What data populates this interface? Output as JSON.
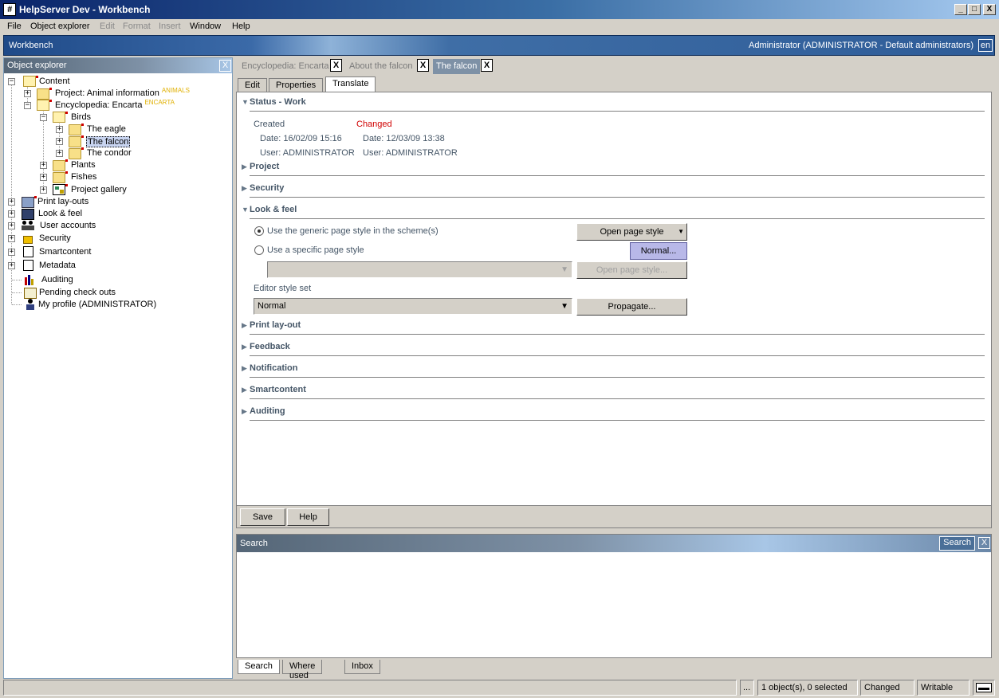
{
  "window": {
    "title": "HelpServer Dev - Workbench",
    "app_icon": "#",
    "minimize": "_",
    "maximize": "□",
    "close": "X"
  },
  "menu": {
    "file": "File",
    "object_explorer": "Object explorer",
    "edit": "Edit",
    "format": "Format",
    "insert": "Insert",
    "window": "Window",
    "help": "Help"
  },
  "header": {
    "title": "Workbench",
    "user": "Administrator (ADMINISTRATOR - Default administrators)",
    "lang": "en"
  },
  "explorer": {
    "title": "Object explorer",
    "close": "X",
    "tree": {
      "content": "Content",
      "project_animal": "Project: Animal information",
      "project_animal_badge": "ANIMALS",
      "encyclopedia": "Encyclopedia: Encarta",
      "encyclopedia_badge": "ENCARTA",
      "birds": "Birds",
      "eagle": "The eagle",
      "falcon": "The falcon",
      "condor": "The condor",
      "plants": "Plants",
      "fishes": "Fishes",
      "project_gallery": "Project gallery",
      "print_layouts": "Print lay-outs",
      "look_feel": "Look & feel",
      "user_accounts": "User accounts",
      "security": "Security",
      "smartcontent": "Smartcontent",
      "metadata": "Metadata",
      "auditing": "Auditing",
      "pending": "Pending check outs",
      "profile": "My profile (ADMINISTRATOR)"
    }
  },
  "doc_tabs": {
    "tab1": "Encyclopedia: Encarta",
    "tab2": "About the falcon",
    "tab3": "The falcon",
    "close": "X"
  },
  "sub_tabs": {
    "edit": "Edit",
    "properties": "Properties",
    "translate": "Translate"
  },
  "sections": {
    "status": "Status - Work",
    "project": "Project",
    "security": "Security",
    "look_feel": "Look & feel",
    "print_layout": "Print lay-out",
    "feedback": "Feedback",
    "notification": "Notification",
    "smartcontent": "Smartcontent",
    "auditing": "Auditing"
  },
  "status": {
    "created_label": "Created",
    "changed_label": "Changed",
    "created_date": "Date:  16/02/09 15:16",
    "created_user": "User:  ADMINISTRATOR",
    "changed_date": "Date:  12/03/09 13:38",
    "changed_user": "User:  ADMINISTRATOR"
  },
  "look_feel": {
    "generic_radio": "Use the generic page style in the scheme(s)",
    "specific_radio": "Use a specific page style",
    "open_page_style": "Open page style",
    "open_page_style_disabled": "Open page style...",
    "dropdown_option": "Normal...",
    "editor_style_label": "Editor style set",
    "editor_style_value": "Normal",
    "propagate": "Propagate...",
    "arrow": "▼"
  },
  "footer": {
    "save": "Save",
    "help": "Help"
  },
  "search": {
    "title": "Search",
    "button": "Search",
    "close": "X"
  },
  "bottom_tabs": {
    "search": "Search",
    "where_used": "Where used",
    "inbox": "Inbox"
  },
  "statusbar": {
    "ellipsis": "...",
    "objects": "1 object(s), 0 selected",
    "changed": "Changed",
    "writable": "Writable"
  }
}
